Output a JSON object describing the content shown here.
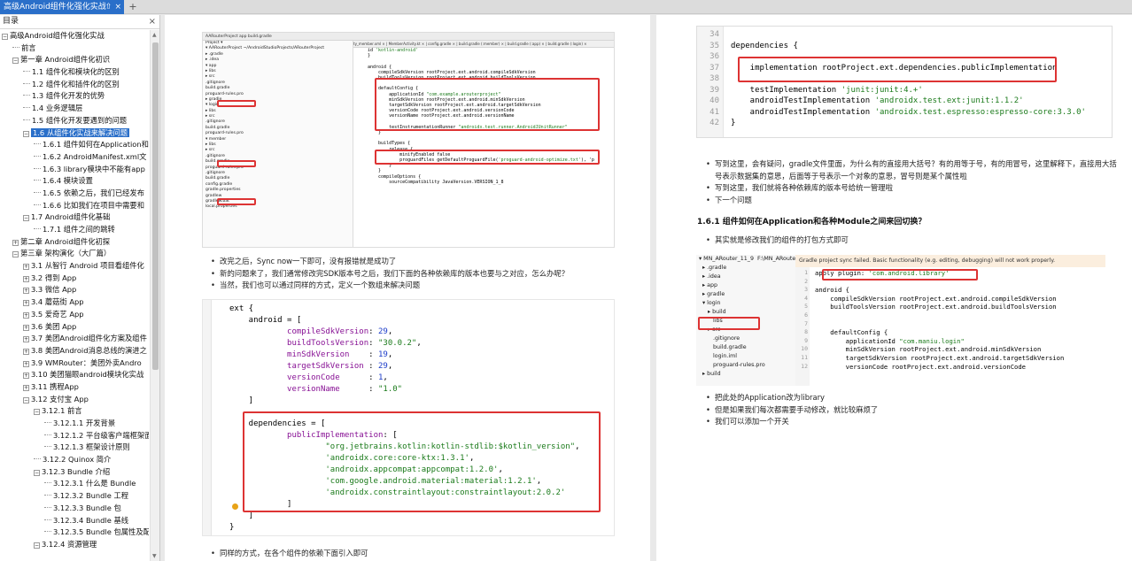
{
  "tab": {
    "title": "高级Android组件化强化实战",
    "pin": "⇧",
    "close": "×",
    "add": "+"
  },
  "sidebar": {
    "title": "目录",
    "close": "×",
    "toc": [
      {
        "label": "高级Android组件化强化实战",
        "level": 0,
        "toggle": "−"
      },
      {
        "label": "前言",
        "level": 1
      },
      {
        "label": "第一章 Android组件化初识",
        "level": 1,
        "toggle": "−"
      },
      {
        "label": "1.1 组件化和模块化的区别",
        "level": 2
      },
      {
        "label": "1.2 组件化和插件化的区别",
        "level": 2
      },
      {
        "label": "1.3 组件化开发的优势",
        "level": 2
      },
      {
        "label": "1.4 业务逻辑层",
        "level": 2
      },
      {
        "label": "1.5 组件化开发要遇到的问题",
        "level": 2
      },
      {
        "label": "1.6 从组件化实战来解决问题",
        "level": 2,
        "toggle": "−",
        "selected": true
      },
      {
        "label": "1.6.1 组件如何在Application和",
        "level": 3
      },
      {
        "label": "1.6.2 AndroidManifest.xml文",
        "level": 3
      },
      {
        "label": "1.6.3 library模块中不能有app",
        "level": 3
      },
      {
        "label": "1.6.4 模块设置",
        "level": 3
      },
      {
        "label": "1.6.5 依赖之后，我们已经发布",
        "level": 3
      },
      {
        "label": "1.6.6 比如我们在项目中需要和",
        "level": 3
      },
      {
        "label": "1.7 Android组件化基础",
        "level": 2,
        "toggle": "−"
      },
      {
        "label": "1.7.1 组件之间的跳转",
        "level": 3
      },
      {
        "label": "第二章 Android组件化初探",
        "level": 1,
        "toggle": "+"
      },
      {
        "label": "第三章 架构演化（大厂篇）",
        "level": 1,
        "toggle": "−"
      },
      {
        "label": "3.1 从智行 Android 项目看组件化",
        "level": 2,
        "toggle": "+"
      },
      {
        "label": "3.2 得到 App",
        "level": 2,
        "toggle": "+"
      },
      {
        "label": "3.3 微信 App",
        "level": 2,
        "toggle": "+"
      },
      {
        "label": "3.4 蘑菇街 App",
        "level": 2,
        "toggle": "+"
      },
      {
        "label": "3.5 爱奇艺 App",
        "level": 2,
        "toggle": "+"
      },
      {
        "label": "3.6 美团 App",
        "level": 2,
        "toggle": "+"
      },
      {
        "label": "3.7 美团Android组件化方案及组件",
        "level": 2,
        "toggle": "+"
      },
      {
        "label": "3.8 美团Android消息总线的演进之",
        "level": 2,
        "toggle": "+"
      },
      {
        "label": "3.9 WMRouter：美团外卖Andro",
        "level": 2,
        "toggle": "+"
      },
      {
        "label": "3.10 美团猫眼android模块化实战",
        "level": 2,
        "toggle": "+"
      },
      {
        "label": "3.11 携程App",
        "level": 2,
        "toggle": "+"
      },
      {
        "label": "3.12 支付宝 App",
        "level": 2,
        "toggle": "−"
      },
      {
        "label": "3.12.1 前言",
        "level": 3,
        "toggle": "−"
      },
      {
        "label": "3.12.1.1 开发背景",
        "level": 4
      },
      {
        "label": "3.12.1.2 平台级客户端框架面临",
        "level": 4
      },
      {
        "label": "3.12.1.3 框架设计原则",
        "level": 4
      },
      {
        "label": "3.12.2 Quinox 简介",
        "level": 3
      },
      {
        "label": "3.12.3 Bundle 介绍",
        "level": 3,
        "toggle": "−"
      },
      {
        "label": "3.12.3.1 什么是 Bundle",
        "level": 4
      },
      {
        "label": "3.12.3.2 Bundle 工程",
        "level": 4
      },
      {
        "label": "3.12.3.3 Bundle 包",
        "level": 4
      },
      {
        "label": "3.12.3.4 Bundle 基线",
        "level": 4
      },
      {
        "label": "3.12.3.5 Bundle 包属性及配置",
        "level": 4
      },
      {
        "label": "3.12.4 资源管理",
        "level": 3,
        "toggle": "−"
      }
    ]
  },
  "left_page": {
    "ide_toolbar": "AARouterProject  app  build.gradle",
    "ide_tabs": "ty_member.xml × | MemberActivity.kt × | config.gradle × | build.gradle (:member) × | build.gradle (:app) × | build.gradle (:login) ×",
    "ide_tree": [
      "Project ▾",
      "▾ AARouterProject ~/AndroidStudioProjects/ARouterProject",
      "  ▸ .gradle",
      "  ▸ .idea",
      "  ▾ app",
      "    ▸ libs",
      "    ▸ src",
      "      .gitignore",
      "      build.gradle",
      "      proguard-rules.pro",
      "  ▸ gradle",
      "  ▾ login",
      "    ▸ libs",
      "    ▸ src",
      "      .gitignore",
      "      build.gradle",
      "      proguard-rules.pro",
      "  ▾ member",
      "    ▸ libs",
      "    ▸ src",
      "      .gitignore",
      "      build.gradle",
      "      proguard-rules.pro",
      "    .gitignore",
      "    build.gradle",
      "    config.gradle",
      "    gradle.properties",
      "    gradlew",
      "    gradlew.bat",
      "    local.properties"
    ],
    "ide_code": [
      "id 'kotlin-android'",
      "}",
      "",
      "android {",
      "    compileSdkVersion rootProject.ext.android.compileSdkVersion",
      "    buildToolsVersion rootProject.ext.android.buildToolsVersion",
      "",
      "    defaultConfig {",
      "        applicationId \"com.example.arouterproject\"",
      "        minSdkVersion rootProject.ext.android.minSdkVersion",
      "        targetSdkVersion rootProject.ext.android.targetSdkVersion",
      "        versionCode rootProject.ext.android.versionCode",
      "        versionName rootProject.ext.android.versionName",
      "",
      "        testInstrumentationRunner \"androidx.test.runner.AndroidJUnitRunner\"",
      "    }",
      "",
      "    buildTypes {",
      "        release {",
      "            minifyEnabled false",
      "            proguardFiles getDefaultProguardFile('proguard-android-optimize.txt'), 'p",
      "        }",
      "    }",
      "    compileOptions {",
      "        sourceCompatibility JavaVersion.VERSION_1_8"
    ],
    "bullets": [
      "改完之后，Sync now一下即可，没有报错就是成功了",
      "新的问题来了，我们通常修改完SDK版本号之后，我们下面的各种依赖库的版本也要与之对应，怎么办呢？",
      "当然，我们也可以通过同样的方式，定义一个数组来解决问题"
    ],
    "code_lines": [
      "ext {",
      "    android = [",
      "            compileSdkVersion: 29,",
      "            buildToolsVersion: \"30.0.2\",",
      "            minSdkVersion    : 19,",
      "            targetSdkVersion : 29,",
      "            versionCode      : 1,",
      "            versionName      : \"1.0\"",
      "    ]",
      "",
      "    dependencies = [",
      "            publicImplementation: [",
      "                    \"org.jetbrains.kotlin:kotlin-stdlib:$kotlin_version\",",
      "                    'androidx.core:core-ktx:1.3.1',",
      "                    'androidx.appcompat:appcompat:1.2.0',",
      "                    'com.google.android.material:material:1.2.1',",
      "                    'androidx.constraintlayout:constraintlayout:2.0.2'",
      "            ]",
      "    ]",
      "}"
    ],
    "bottom_bullet": "同样的方式，在各个组件的依赖下面引入即可"
  },
  "right_page": {
    "top_code_lines": [
      {
        "n": "34",
        "t": ""
      },
      {
        "n": "35",
        "t": "dependencies {"
      },
      {
        "n": "36",
        "t": ""
      },
      {
        "n": "37",
        "t": "    implementation rootProject.ext.dependencies.publicImplementation"
      },
      {
        "n": "38",
        "t": ""
      },
      {
        "n": "39",
        "t": "    testImplementation 'junit:junit:4.+'"
      },
      {
        "n": "40",
        "t": "    androidTestImplementation 'androidx.test.ext:junit:1.1.2'"
      },
      {
        "n": "41",
        "t": "    androidTestImplementation 'androidx.test.espresso:espresso-core:3.3.0'"
      },
      {
        "n": "42",
        "t": "}"
      }
    ],
    "bullets1": [
      "写到这里，会有疑问，gradle文件里面，为什么有的直接用大括号？有的用等于号，有的用冒号，这里解释下，直接用大括号表示数据集的意思，后面等于号表示一个对象的意思，冒号则是某个属性啦",
      "写到这里，我们就将各种依赖库的版本号给统一管理啦",
      "下一个问题"
    ],
    "heading": "1.6.1 组件如何在Application和各种Module之间来回切换？",
    "bullets2": [
      "其实就是修改我们的组件的打包方式即可"
    ],
    "shot2": {
      "tree": [
        "▾ MN_ARouter_11_9  F:\\MN_ARouter",
        "  ▸ .gradle",
        "  ▸ .idea",
        "  ▸ app",
        "  ▸ gradle",
        "  ▾ login",
        "     ▸ build",
        "        libs",
        "     ▸ src",
        "        .gitignore",
        "        build.gradle",
        "        login.iml",
        "        proguard-rules.pro",
        "  ▸ build"
      ],
      "banner": "Gradle project sync failed. Basic functionality (e.g. editing, debugging) will not work properly.",
      "code": [
        {
          "n": "1",
          "t": "apply plugin: 'com.android.library'"
        },
        {
          "n": "2",
          "t": ""
        },
        {
          "n": "3",
          "t": "android {"
        },
        {
          "n": "4",
          "t": "    compileSdkVersion rootProject.ext.android.compileSdkVersion"
        },
        {
          "n": "5",
          "t": "    buildToolsVersion rootProject.ext.android.buildToolsVersion"
        },
        {
          "n": "6",
          "t": ""
        },
        {
          "n": "7",
          "t": ""
        },
        {
          "n": "8",
          "t": "    defaultConfig {"
        },
        {
          "n": "9",
          "t": "        applicationId \"com.maniu.login\""
        },
        {
          "n": "10",
          "t": "        minSdkVersion rootProject.ext.android.minSdkVersion"
        },
        {
          "n": "11",
          "t": "        targetSdkVersion rootProject.ext.android.targetSdkVersion"
        },
        {
          "n": "12",
          "t": "        versionCode rootProject.ext.android.versionCode"
        }
      ]
    },
    "bullets3": [
      "把此处的Application改为library",
      "但是如果我们每次都需要手动修改，就比较麻烦了",
      "我们可以添加一个开关"
    ]
  }
}
